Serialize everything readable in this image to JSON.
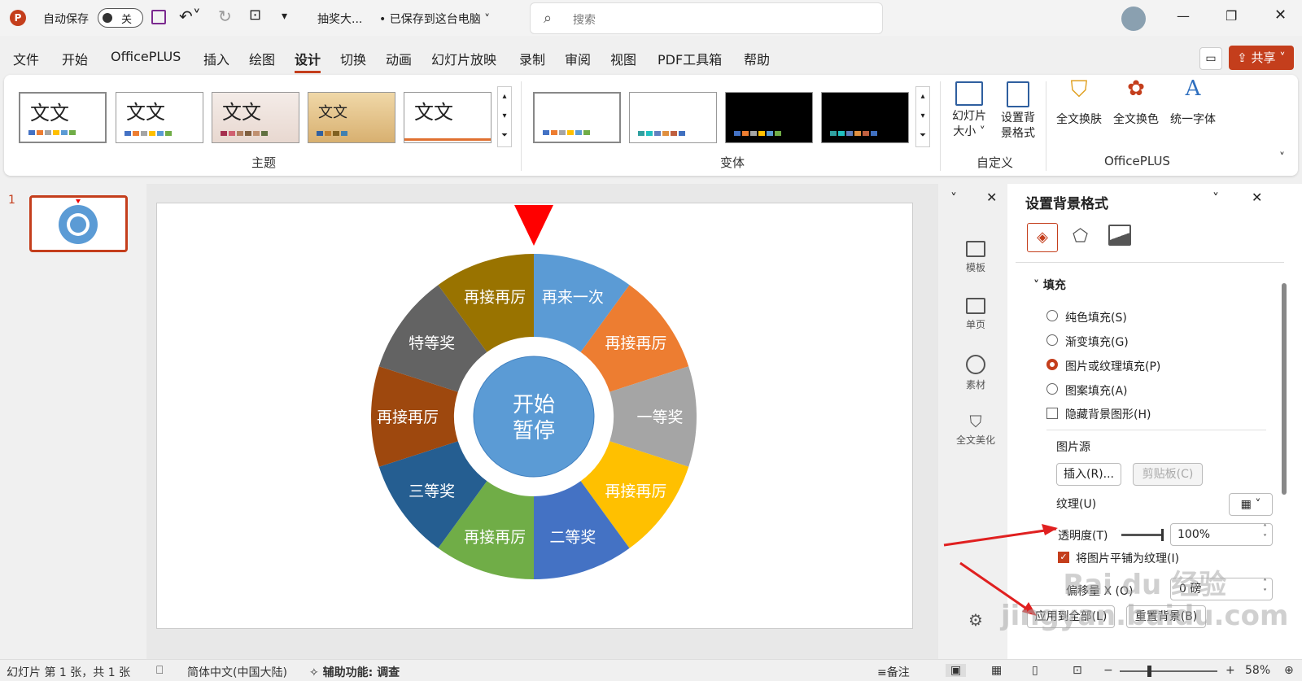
{
  "titlebar": {
    "autosave_label": "自动保存",
    "toggle_state": "关",
    "filename": "抽奖大...",
    "save_status": "• 已保存到这台电脑"
  },
  "search": {
    "placeholder": "搜索"
  },
  "menu": [
    "文件",
    "开始",
    "OfficePLUS",
    "插入",
    "绘图",
    "设计",
    "切换",
    "动画",
    "幻灯片放映",
    "录制",
    "审阅",
    "视图",
    "PDF工具箱",
    "帮助"
  ],
  "share_label": "共享",
  "ribbon": {
    "theme_text": "文文",
    "group_theme": "主题",
    "group_variant": "变体",
    "group_custom": "自定义",
    "group_officeplus": "OfficePLUS",
    "slide_size": "幻灯片\n大小 ˅",
    "bg_format": "设置背\n景格式",
    "op_buttons": [
      "全文换肤",
      "全文换色",
      "统一字体"
    ]
  },
  "slide_number": "1",
  "wheel": {
    "center": [
      "开始",
      "暂停"
    ],
    "segments": [
      {
        "label": "再来一次",
        "color": "#5b9bd5"
      },
      {
        "label": "再接再厉",
        "color": "#ed7d31"
      },
      {
        "label": "一等奖",
        "color": "#a5a5a5"
      },
      {
        "label": "再接再厉",
        "color": "#ffc000"
      },
      {
        "label": "二等奖",
        "color": "#4472c4"
      },
      {
        "label": "再接再厉",
        "color": "#70ad47"
      },
      {
        "label": "三等奖",
        "color": "#255e91"
      },
      {
        "label": "再接再厉",
        "color": "#9e480e"
      },
      {
        "label": "特等奖",
        "color": "#636363"
      },
      {
        "label": "再接再厉",
        "color": "#997300"
      }
    ]
  },
  "side_icons": [
    "模板",
    "单页",
    "素材",
    "全文美化"
  ],
  "panel": {
    "title": "设置背景格式",
    "section": "填充",
    "options": [
      "纯色填充(S)",
      "渐变填充(G)",
      "图片或纹理填充(P)",
      "图案填充(A)"
    ],
    "hide_bg": "隐藏背景图形(H)",
    "picture_source": "图片源",
    "insert": "插入(R)...",
    "clipboard": "剪贴板(C)",
    "texture": "纹理(U)",
    "transparency": "透明度(T)",
    "transparency_value": "100%",
    "tile": "将图片平铺为纹理(I)",
    "offset": "偏移量 X (O)",
    "offset_value": "0 磅",
    "apply_all": "应用到全部(L)",
    "reset_bg": "重置背景(B)"
  },
  "status": {
    "slide": "幻灯片 第 1 张，共 1 张",
    "lang": "简体中文(中国大陆)",
    "access": "辅助功能: 调查",
    "notes": "备注",
    "zoom": "58%"
  },
  "watermark": "Bai du 经验\njingyan.baidu.com",
  "colors": {
    "accent": "#c43e1c"
  }
}
